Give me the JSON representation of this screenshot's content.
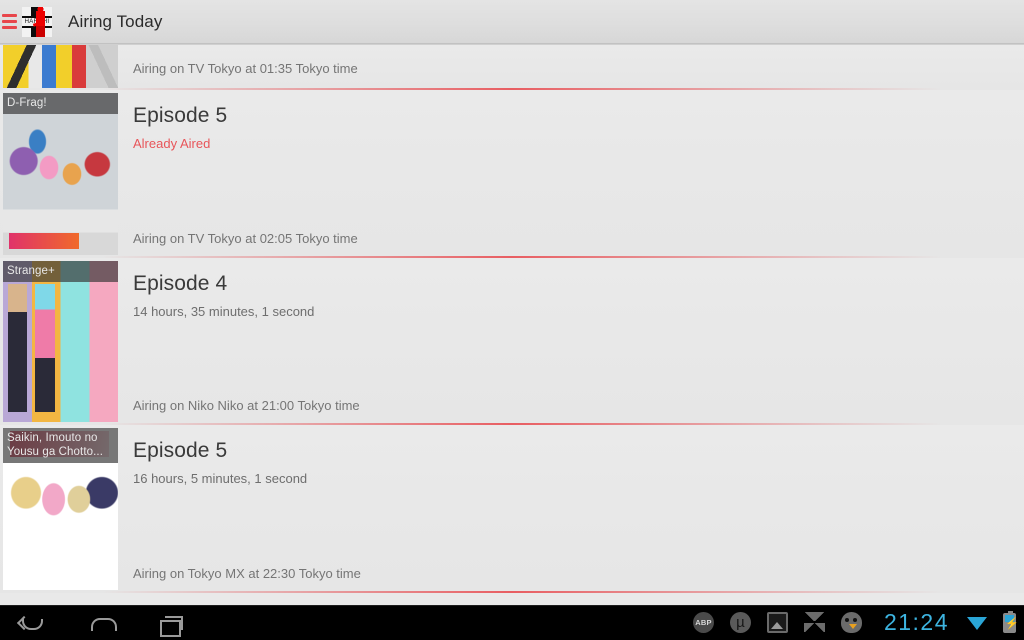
{
  "app": {
    "title": "Airing Today",
    "menu_icon": "hamburger-icon",
    "icon_text": "HARUHI"
  },
  "list": [
    {
      "show_title": "",
      "episode": "",
      "countdown": "",
      "airing": "Airing on TV Tokyo at 01:35 Tokyo time",
      "aired": false,
      "art": "art-bike",
      "partial": true
    },
    {
      "show_title": "D-Frag!",
      "episode": "Episode 5",
      "countdown": "Already Aired",
      "airing": "Airing on TV Tokyo at 02:05 Tokyo time",
      "aired": true,
      "art": "art-dfrag",
      "partial": false
    },
    {
      "show_title": "Strange+",
      "episode": "Episode 4",
      "countdown": "14 hours, 35 minutes, 1 second",
      "airing": "Airing on Niko Niko at 21:00 Tokyo time",
      "aired": false,
      "art": "art-strange",
      "partial": false
    },
    {
      "show_title": "Saikin, Imouto no Yousu ga Chotto...",
      "episode": "Episode 5",
      "countdown": "16 hours, 5 minutes, 1 second",
      "airing": "Airing on Tokyo MX at 22:30 Tokyo time",
      "aired": false,
      "art": "art-saikin",
      "partial": false
    }
  ],
  "navbar": {
    "back_label": "back-icon",
    "home_label": "home-icon",
    "recents_label": "recents-icon",
    "tray": [
      {
        "name": "adblock-plus-icon",
        "text": "ABP"
      },
      {
        "name": "utorrent-icon",
        "text": ""
      },
      {
        "name": "gallery-icon",
        "text": ""
      },
      {
        "name": "dropbox-icon",
        "text": ""
      },
      {
        "name": "twitter-bird-icon",
        "text": ""
      }
    ],
    "clock": "21:24",
    "wifi_icon": "wifi-icon",
    "battery_icon": "battery-charging-icon"
  },
  "colors": {
    "accent_red": "#e8464b",
    "aired_red": "#e8555a",
    "clock_blue": "#3db4e0",
    "list_bg": "#e8e8e8"
  }
}
